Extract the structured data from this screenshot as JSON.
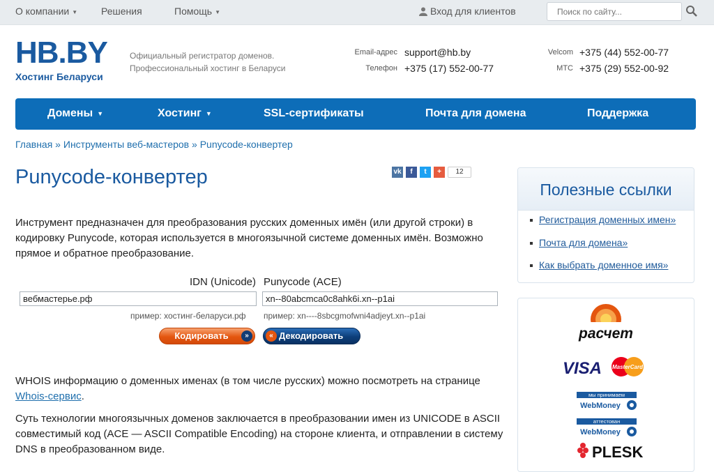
{
  "topbar": {
    "about": "О компании",
    "solutions": "Решения",
    "help": "Помощь",
    "login": "Вход для клиентов",
    "search_placeholder": "Поиск по сайту..."
  },
  "header": {
    "logo_main": "HB.BY",
    "logo_sub": "Хостинг Беларуси",
    "tagline_1": "Официальный регистратор доменов.",
    "tagline_2": "Профессиональный хостинг в Беларуси",
    "email_label": "Email-адрес",
    "email": "support@hb.by",
    "phone_label": "Телефон",
    "phone": "+375 (17) 552-00-77",
    "velcom_label": "Velcom",
    "velcom": "+375 (44) 552-00-77",
    "mts_label": "МТС",
    "mts": "+375 (29) 552-00-92"
  },
  "nav": {
    "domains": "Домены",
    "hosting": "Хостинг",
    "ssl": "SSL-сертификаты",
    "mail": "Почта для домена",
    "support": "Поддержка"
  },
  "breadcrumb": {
    "home": "Главная",
    "tools": "Инструменты веб-мастеров",
    "current": "Punycode-конвертер"
  },
  "page": {
    "title": "Punycode-конвертер",
    "share_count": "12",
    "intro": "Инструмент предназначен для преобразования русских доменных имён (или другой строки) в кодировку Punycode, которая используется в многоязычной системе доменных имён. Возможно прямое и обратное преобразование."
  },
  "converter": {
    "idn_label": "IDN (Unicode)",
    "puny_label": "Punycode (ACE)",
    "idn_value": "вебмастерье.рф",
    "puny_value": "xn--80abcmca0c8ahk6i.xn--p1ai",
    "idn_example": "пример: хостинг-беларуси.рф",
    "puny_example": "пример: xn----8sbcgmofwni4adjeyt.xn--p1ai",
    "encode_label": "Кодировать",
    "decode_label": "Декодировать"
  },
  "text": {
    "whois_before": "WHOIS информацию о доменных именах (в том числе русских) можно посмотреть на странице",
    "whois_link": "Whois-сервис",
    "whois_after": ".",
    "tech": "Суть технологии многоязычных доменов заключается в преобразовании имен из UNICODE в ASCII совместимый код (ACE — ASCII Compatible Encoding) на стороне клиента, и отправлении в систему DNS в преобразованном виде."
  },
  "sidebar": {
    "title": "Полезные ссылки",
    "links": [
      "Регистрация доменных имен»",
      "Почта для домена»",
      "Как выбрать доменное имя»"
    ]
  },
  "payments": {
    "raschet": "расчет",
    "visa": "VISA",
    "mastercard": "MasterCard",
    "wm_accept_top": "мы принимаем",
    "wm_accept_bottom": "WebMoney",
    "wm_cert_top": "аттестован",
    "wm_cert_bottom": "WebMoney",
    "plesk": "PLESK"
  },
  "colors": {
    "brand_blue": "#0d6db8",
    "link_blue": "#1f6fad",
    "orange": "#e4560f"
  }
}
